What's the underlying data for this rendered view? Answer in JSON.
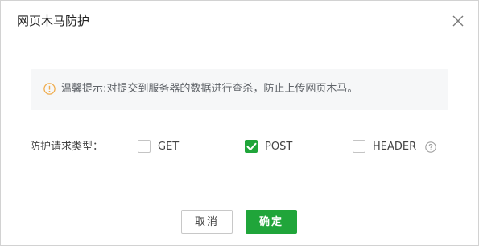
{
  "dialog": {
    "title": "网页木马防护",
    "close_icon": "close-icon"
  },
  "tip": {
    "icon": "warning-circle-icon",
    "text": "温馨提示:对提交到服务器的数据进行查杀，防止上传网页木马。",
    "icon_color": "#f0ad4e"
  },
  "form": {
    "label": "防护请求类型：",
    "options": [
      {
        "label": "GET",
        "checked": false
      },
      {
        "label": "POST",
        "checked": true
      },
      {
        "label": "HEADER",
        "checked": false
      }
    ],
    "help_icon": "question-circle-icon"
  },
  "footer": {
    "cancel_label": "取消",
    "confirm_label": "确定"
  },
  "colors": {
    "accent": "#20a53a",
    "warning": "#f0ad4e"
  }
}
